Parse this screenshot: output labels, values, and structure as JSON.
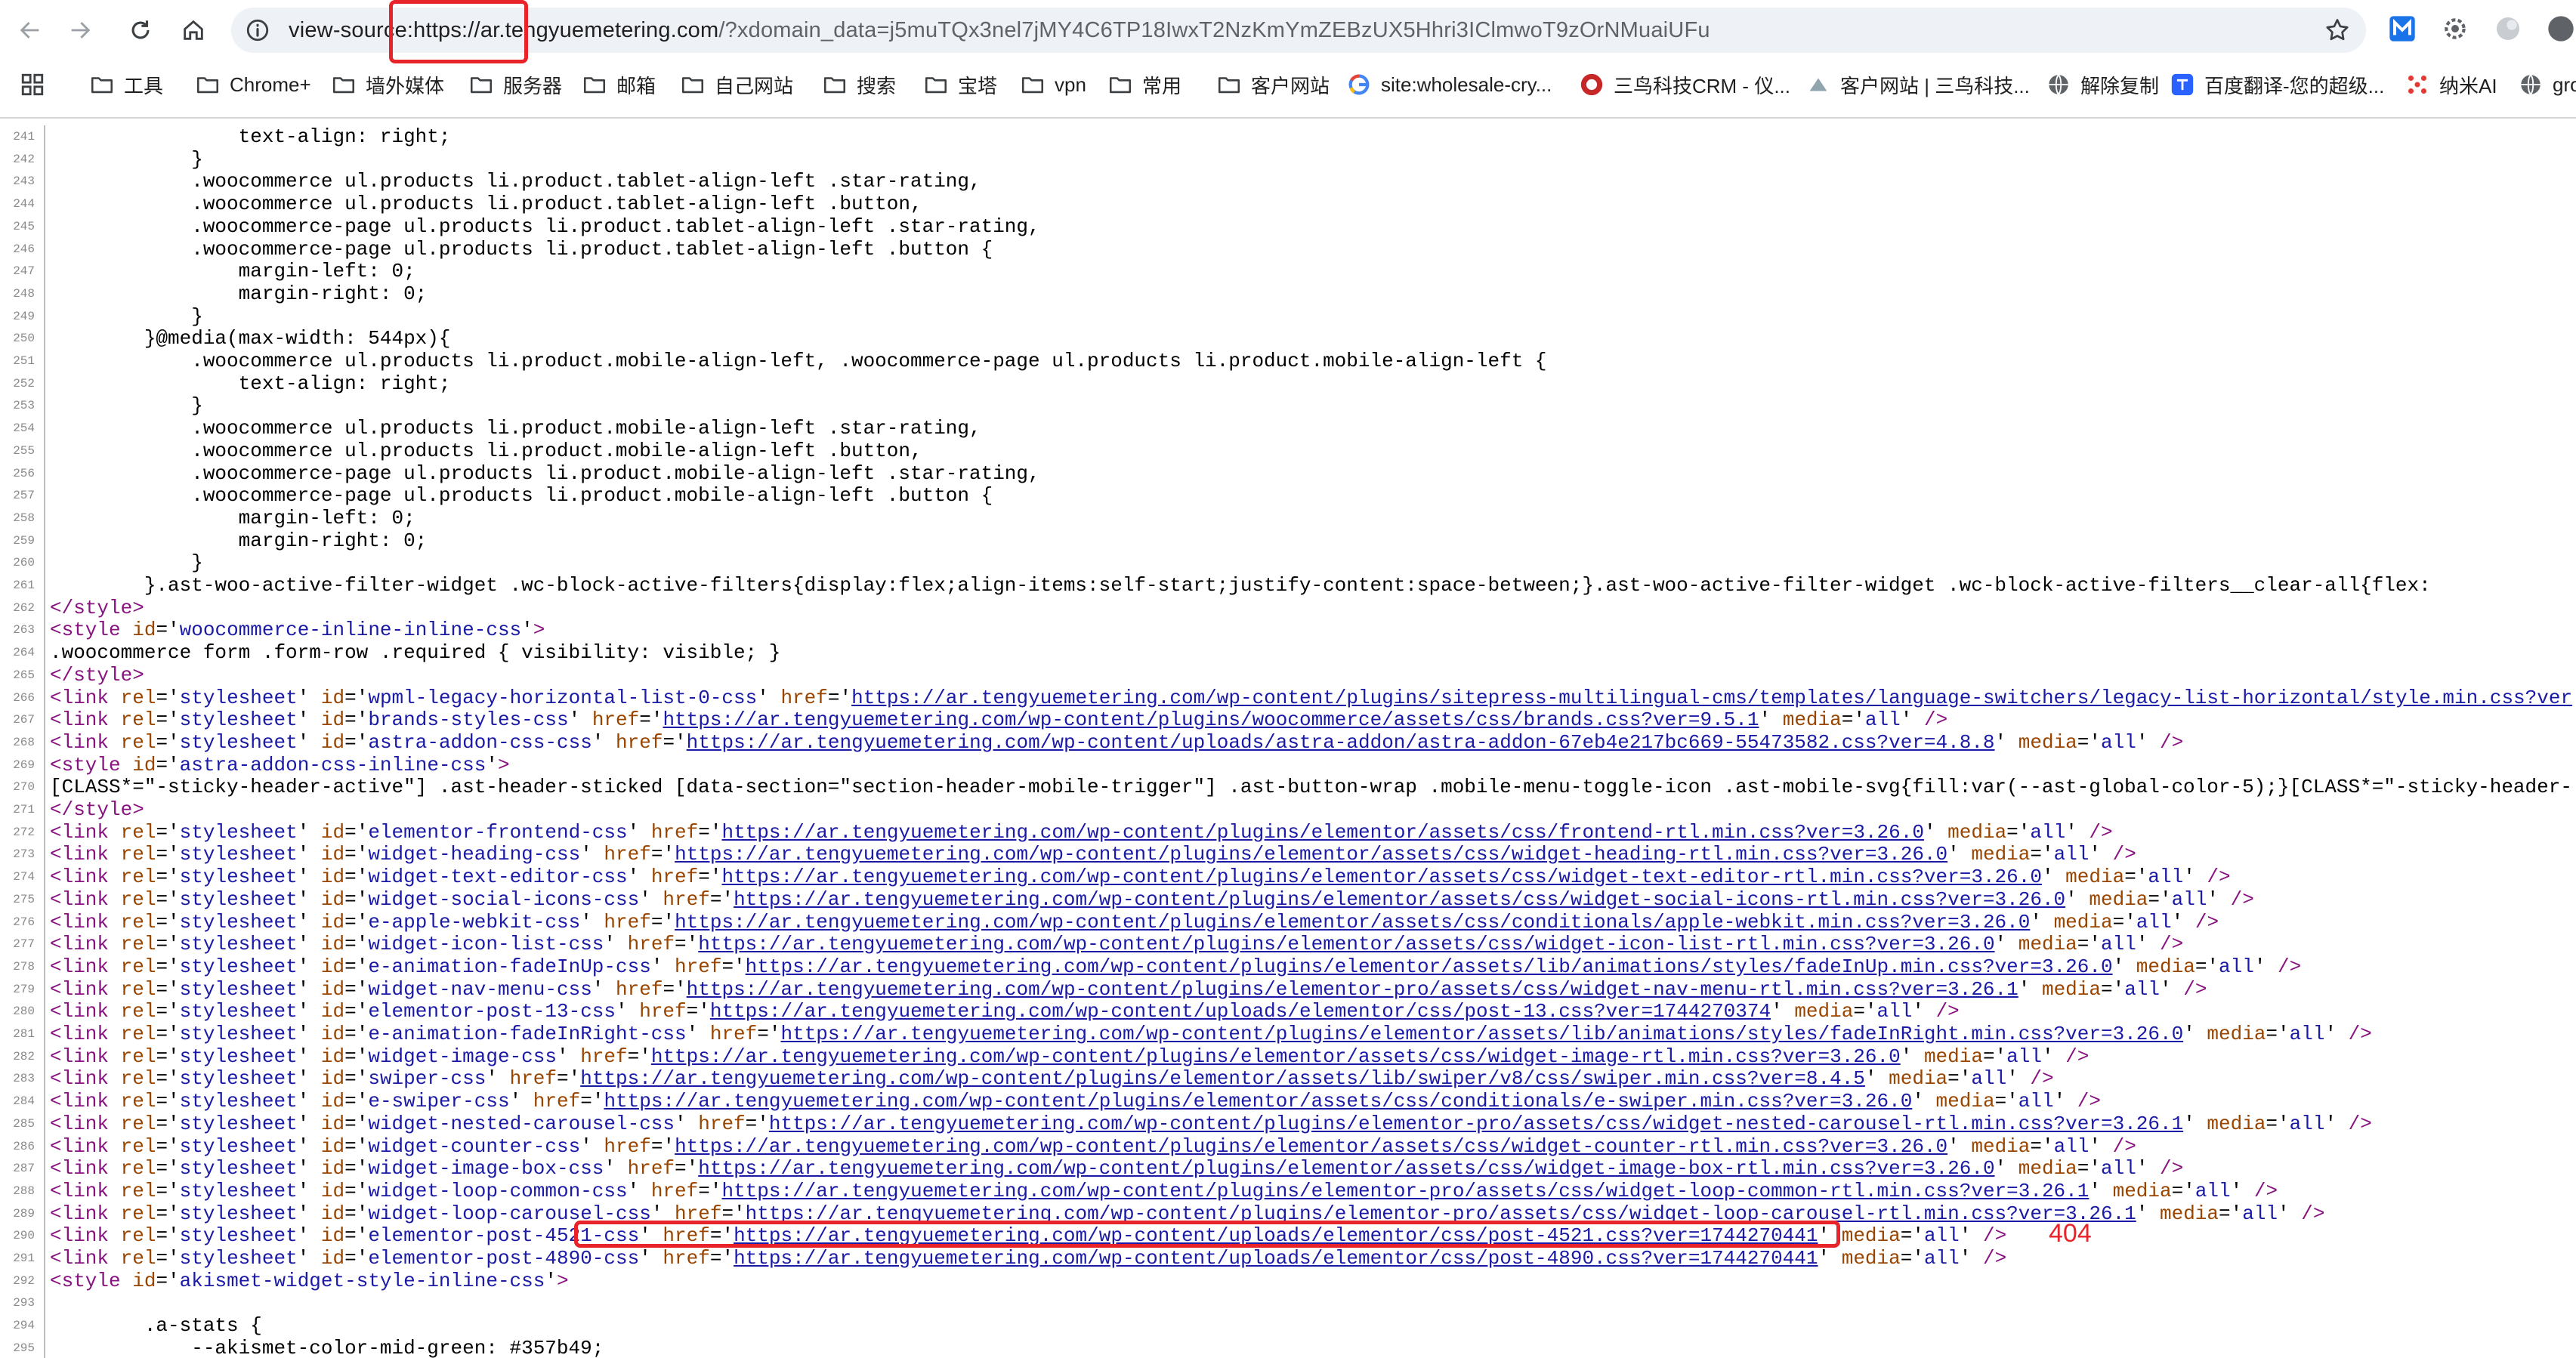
{
  "browser": {
    "url_prefix": "view-source:https://ar.",
    "url_domain": "tengyuemetering.com",
    "url_rest": "/?xdomain_data=j5muTQx3nel7jMY4C6TP18IwxT2NzKmYmZEBzUX5Hhri3IClmwoT9zOrNMuaiUFu"
  },
  "bookmarks": [
    {
      "label": "工具",
      "icon": "folder-icon"
    },
    {
      "label": "Chrome+",
      "icon": "folder-icon"
    },
    {
      "label": "墙外媒体",
      "icon": "folder-icon"
    },
    {
      "label": "服务器",
      "icon": "folder-icon"
    },
    {
      "label": "邮箱",
      "icon": "folder-icon"
    },
    {
      "label": "自己网站",
      "icon": "folder-icon"
    },
    {
      "label": "搜索",
      "icon": "folder-icon"
    },
    {
      "label": "宝塔",
      "icon": "folder-icon"
    },
    {
      "label": "vpn",
      "icon": "folder-icon"
    },
    {
      "label": "常用",
      "icon": "folder-icon"
    },
    {
      "label": "客户网站",
      "icon": "folder-icon"
    },
    {
      "label": "site:wholesale-cry...",
      "icon": "google-icon"
    },
    {
      "label": "三鸟科技CRM - 仪...",
      "icon": "crm-logo-icon"
    },
    {
      "label": "客户网站 | 三鸟科技...",
      "icon": "site-logo-icon"
    },
    {
      "label": "解除复制",
      "icon": "globe-icon"
    },
    {
      "label": "百度翻译-您的超级...",
      "icon": "translate-icon"
    },
    {
      "label": "纳米AI",
      "icon": "nami-icon"
    },
    {
      "label": "gro",
      "icon": "globe-icon"
    }
  ],
  "annotation": {
    "note": "404"
  },
  "source_lines": [
    {
      "n": "241",
      "t": "                text-align: right;"
    },
    {
      "n": "242",
      "t": "            }"
    },
    {
      "n": "243",
      "t": "            .woocommerce ul.products li.product.tablet-align-left .star-rating,"
    },
    {
      "n": "244",
      "t": "            .woocommerce ul.products li.product.tablet-align-left .button,"
    },
    {
      "n": "245",
      "t": "            .woocommerce-page ul.products li.product.tablet-align-left .star-rating,"
    },
    {
      "n": "246",
      "t": "            .woocommerce-page ul.products li.product.tablet-align-left .button {"
    },
    {
      "n": "247",
      "t": "                margin-left: 0;"
    },
    {
      "n": "248",
      "t": "                margin-right: 0;"
    },
    {
      "n": "249",
      "t": "            }"
    },
    {
      "n": "250",
      "t": "        }@media(max-width: 544px){"
    },
    {
      "n": "251",
      "t": "            .woocommerce ul.products li.product.mobile-align-left, .woocommerce-page ul.products li.product.mobile-align-left {"
    },
    {
      "n": "252",
      "t": "                text-align: right;"
    },
    {
      "n": "253",
      "t": "            }"
    },
    {
      "n": "254",
      "t": "            .woocommerce ul.products li.product.mobile-align-left .star-rating,"
    },
    {
      "n": "255",
      "t": "            .woocommerce ul.products li.product.mobile-align-left .button,"
    },
    {
      "n": "256",
      "t": "            .woocommerce-page ul.products li.product.mobile-align-left .star-rating,"
    },
    {
      "n": "257",
      "t": "            .woocommerce-page ul.products li.product.mobile-align-left .button {"
    },
    {
      "n": "258",
      "t": "                margin-left: 0;"
    },
    {
      "n": "259",
      "t": "                margin-right: 0;"
    },
    {
      "n": "260",
      "t": "            }"
    },
    {
      "n": "261",
      "t": "        }.ast-woo-active-filter-widget .wc-block-active-filters{display:flex;align-items:self-start;justify-content:space-between;}.ast-woo-active-filter-widget .wc-block-active-filters__clear-all{flex:"
    },
    {
      "n": "262",
      "tag": "</style>"
    },
    {
      "n": "263",
      "tag": "<style",
      "attrs": [
        {
          "a": "id",
          "v": "woocommerce-inline-inline-css"
        }
      ],
      "close": ">"
    },
    {
      "n": "264",
      "t": ".woocommerce form .form-row .required { visibility: visible; }"
    },
    {
      "n": "265",
      "tag": "</style>"
    },
    {
      "n": "266",
      "tag": "<link",
      "attrs": [
        {
          "a": "rel",
          "v": "stylesheet"
        },
        {
          "a": "id",
          "v": "wpml-legacy-horizontal-list-0-css"
        },
        {
          "a": "href",
          "link": "https://ar.tengyuemetering.com/wp-content/plugins/sitepress-multilingual-cms/templates/language-switchers/legacy-list-horizontal/style.min.css?ver"
        }
      ],
      "close": ""
    },
    {
      "n": "267",
      "tag": "<link",
      "attrs": [
        {
          "a": "rel",
          "v": "stylesheet"
        },
        {
          "a": "id",
          "v": "brands-styles-css"
        },
        {
          "a": "href",
          "link": "https://ar.tengyuemetering.com/wp-content/plugins/woocommerce/assets/css/brands.css?ver=9.5.1"
        },
        {
          "a": "media",
          "v": "all"
        }
      ],
      "close": " />"
    },
    {
      "n": "268",
      "tag": "<link",
      "attrs": [
        {
          "a": "rel",
          "v": "stylesheet"
        },
        {
          "a": "id",
          "v": "astra-addon-css-css"
        },
        {
          "a": "href",
          "link": "https://ar.tengyuemetering.com/wp-content/uploads/astra-addon/astra-addon-67eb4e217bc669-55473582.css?ver=4.8.8"
        },
        {
          "a": "media",
          "v": "all"
        }
      ],
      "close": " />"
    },
    {
      "n": "269",
      "tag": "<style",
      "attrs": [
        {
          "a": "id",
          "v": "astra-addon-css-inline-css"
        }
      ],
      "close": ">"
    },
    {
      "n": "270",
      "t": "[CLASS*=\"-sticky-header-active\"] .ast-header-sticked [data-section=\"section-header-mobile-trigger\"] .ast-button-wrap .mobile-menu-toggle-icon .ast-mobile-svg{fill:var(--ast-global-color-5);}[CLASS*=\"-sticky-header-"
    },
    {
      "n": "271",
      "tag": "</style>"
    },
    {
      "n": "272",
      "tag": "<link",
      "attrs": [
        {
          "a": "rel",
          "v": "stylesheet"
        },
        {
          "a": "id",
          "v": "elementor-frontend-css"
        },
        {
          "a": "href",
          "link": "https://ar.tengyuemetering.com/wp-content/plugins/elementor/assets/css/frontend-rtl.min.css?ver=3.26.0"
        },
        {
          "a": "media",
          "v": "all"
        }
      ],
      "close": " />"
    },
    {
      "n": "273",
      "tag": "<link",
      "attrs": [
        {
          "a": "rel",
          "v": "stylesheet"
        },
        {
          "a": "id",
          "v": "widget-heading-css"
        },
        {
          "a": "href",
          "link": "https://ar.tengyuemetering.com/wp-content/plugins/elementor/assets/css/widget-heading-rtl.min.css?ver=3.26.0"
        },
        {
          "a": "media",
          "v": "all"
        }
      ],
      "close": " />"
    },
    {
      "n": "274",
      "tag": "<link",
      "attrs": [
        {
          "a": "rel",
          "v": "stylesheet"
        },
        {
          "a": "id",
          "v": "widget-text-editor-css"
        },
        {
          "a": "href",
          "link": "https://ar.tengyuemetering.com/wp-content/plugins/elementor/assets/css/widget-text-editor-rtl.min.css?ver=3.26.0"
        },
        {
          "a": "media",
          "v": "all"
        }
      ],
      "close": " />"
    },
    {
      "n": "275",
      "tag": "<link",
      "attrs": [
        {
          "a": "rel",
          "v": "stylesheet"
        },
        {
          "a": "id",
          "v": "widget-social-icons-css"
        },
        {
          "a": "href",
          "link": "https://ar.tengyuemetering.com/wp-content/plugins/elementor/assets/css/widget-social-icons-rtl.min.css?ver=3.26.0"
        },
        {
          "a": "media",
          "v": "all"
        }
      ],
      "close": " />"
    },
    {
      "n": "276",
      "tag": "<link",
      "attrs": [
        {
          "a": "rel",
          "v": "stylesheet"
        },
        {
          "a": "id",
          "v": "e-apple-webkit-css"
        },
        {
          "a": "href",
          "link": "https://ar.tengyuemetering.com/wp-content/plugins/elementor/assets/css/conditionals/apple-webkit.min.css?ver=3.26.0"
        },
        {
          "a": "media",
          "v": "all"
        }
      ],
      "close": " />"
    },
    {
      "n": "277",
      "tag": "<link",
      "attrs": [
        {
          "a": "rel",
          "v": "stylesheet"
        },
        {
          "a": "id",
          "v": "widget-icon-list-css"
        },
        {
          "a": "href",
          "link": "https://ar.tengyuemetering.com/wp-content/plugins/elementor/assets/css/widget-icon-list-rtl.min.css?ver=3.26.0"
        },
        {
          "a": "media",
          "v": "all"
        }
      ],
      "close": " />"
    },
    {
      "n": "278",
      "tag": "<link",
      "attrs": [
        {
          "a": "rel",
          "v": "stylesheet"
        },
        {
          "a": "id",
          "v": "e-animation-fadeInUp-css"
        },
        {
          "a": "href",
          "link": "https://ar.tengyuemetering.com/wp-content/plugins/elementor/assets/lib/animations/styles/fadeInUp.min.css?ver=3.26.0"
        },
        {
          "a": "media",
          "v": "all"
        }
      ],
      "close": " />"
    },
    {
      "n": "279",
      "tag": "<link",
      "attrs": [
        {
          "a": "rel",
          "v": "stylesheet"
        },
        {
          "a": "id",
          "v": "widget-nav-menu-css"
        },
        {
          "a": "href",
          "link": "https://ar.tengyuemetering.com/wp-content/plugins/elementor-pro/assets/css/widget-nav-menu-rtl.min.css?ver=3.26.1"
        },
        {
          "a": "media",
          "v": "all"
        }
      ],
      "close": " />"
    },
    {
      "n": "280",
      "tag": "<link",
      "attrs": [
        {
          "a": "rel",
          "v": "stylesheet"
        },
        {
          "a": "id",
          "v": "elementor-post-13-css"
        },
        {
          "a": "href",
          "link": "https://ar.tengyuemetering.com/wp-content/uploads/elementor/css/post-13.css?ver=1744270374"
        },
        {
          "a": "media",
          "v": "all"
        }
      ],
      "close": " />"
    },
    {
      "n": "281",
      "tag": "<link",
      "attrs": [
        {
          "a": "rel",
          "v": "stylesheet"
        },
        {
          "a": "id",
          "v": "e-animation-fadeInRight-css"
        },
        {
          "a": "href",
          "link": "https://ar.tengyuemetering.com/wp-content/plugins/elementor/assets/lib/animations/styles/fadeInRight.min.css?ver=3.26.0"
        },
        {
          "a": "media",
          "v": "all"
        }
      ],
      "close": " />"
    },
    {
      "n": "282",
      "tag": "<link",
      "attrs": [
        {
          "a": "rel",
          "v": "stylesheet"
        },
        {
          "a": "id",
          "v": "widget-image-css"
        },
        {
          "a": "href",
          "link": "https://ar.tengyuemetering.com/wp-content/plugins/elementor/assets/css/widget-image-rtl.min.css?ver=3.26.0"
        },
        {
          "a": "media",
          "v": "all"
        }
      ],
      "close": " />"
    },
    {
      "n": "283",
      "tag": "<link",
      "attrs": [
        {
          "a": "rel",
          "v": "stylesheet"
        },
        {
          "a": "id",
          "v": "swiper-css"
        },
        {
          "a": "href",
          "link": "https://ar.tengyuemetering.com/wp-content/plugins/elementor/assets/lib/swiper/v8/css/swiper.min.css?ver=8.4.5"
        },
        {
          "a": "media",
          "v": "all"
        }
      ],
      "close": " />"
    },
    {
      "n": "284",
      "tag": "<link",
      "attrs": [
        {
          "a": "rel",
          "v": "stylesheet"
        },
        {
          "a": "id",
          "v": "e-swiper-css"
        },
        {
          "a": "href",
          "link": "https://ar.tengyuemetering.com/wp-content/plugins/elementor/assets/css/conditionals/e-swiper.min.css?ver=3.26.0"
        },
        {
          "a": "media",
          "v": "all"
        }
      ],
      "close": " />"
    },
    {
      "n": "285",
      "tag": "<link",
      "attrs": [
        {
          "a": "rel",
          "v": "stylesheet"
        },
        {
          "a": "id",
          "v": "widget-nested-carousel-css"
        },
        {
          "a": "href",
          "link": "https://ar.tengyuemetering.com/wp-content/plugins/elementor-pro/assets/css/widget-nested-carousel-rtl.min.css?ver=3.26.1"
        },
        {
          "a": "media",
          "v": "all"
        }
      ],
      "close": " />"
    },
    {
      "n": "286",
      "tag": "<link",
      "attrs": [
        {
          "a": "rel",
          "v": "stylesheet"
        },
        {
          "a": "id",
          "v": "widget-counter-css"
        },
        {
          "a": "href",
          "link": "https://ar.tengyuemetering.com/wp-content/plugins/elementor/assets/css/widget-counter-rtl.min.css?ver=3.26.0"
        },
        {
          "a": "media",
          "v": "all"
        }
      ],
      "close": " />"
    },
    {
      "n": "287",
      "tag": "<link",
      "attrs": [
        {
          "a": "rel",
          "v": "stylesheet"
        },
        {
          "a": "id",
          "v": "widget-image-box-css"
        },
        {
          "a": "href",
          "link": "https://ar.tengyuemetering.com/wp-content/plugins/elementor/assets/css/widget-image-box-rtl.min.css?ver=3.26.0"
        },
        {
          "a": "media",
          "v": "all"
        }
      ],
      "close": " />"
    },
    {
      "n": "288",
      "tag": "<link",
      "attrs": [
        {
          "a": "rel",
          "v": "stylesheet"
        },
        {
          "a": "id",
          "v": "widget-loop-common-css"
        },
        {
          "a": "href",
          "link": "https://ar.tengyuemetering.com/wp-content/plugins/elementor-pro/assets/css/widget-loop-common-rtl.min.css?ver=3.26.1"
        },
        {
          "a": "media",
          "v": "all"
        }
      ],
      "close": " />"
    },
    {
      "n": "289",
      "tag": "<link",
      "attrs": [
        {
          "a": "rel",
          "v": "stylesheet"
        },
        {
          "a": "id",
          "v": "widget-loop-carousel-css"
        },
        {
          "a": "href",
          "link": "https://ar.tengyuemetering.com/wp-content/plugins/elementor-pro/assets/css/widget-loop-carousel-rtl.min.css?ver=3.26.1"
        },
        {
          "a": "media",
          "v": "all"
        }
      ],
      "close": " />"
    },
    {
      "n": "290",
      "tag": "<link",
      "attrs": [
        {
          "a": "rel",
          "v": "stylesheet"
        },
        {
          "a": "id",
          "v": "elementor-post-4521-css"
        },
        {
          "a": "href",
          "link": "https://ar.tengyuemetering.com/wp-content/uploads/elementor/css/post-4521.css?ver=1744270441"
        },
        {
          "a": "media",
          "v": "all"
        }
      ],
      "close": " />"
    },
    {
      "n": "291",
      "tag": "<link",
      "attrs": [
        {
          "a": "rel",
          "v": "stylesheet"
        },
        {
          "a": "id",
          "v": "elementor-post-4890-css"
        },
        {
          "a": "href",
          "link": "https://ar.tengyuemetering.com/wp-content/uploads/elementor/css/post-4890.css?ver=1744270441"
        },
        {
          "a": "media",
          "v": "all"
        }
      ],
      "close": " />"
    },
    {
      "n": "292",
      "tag": "<style",
      "attrs": [
        {
          "a": "id",
          "v": "akismet-widget-style-inline-css"
        }
      ],
      "close": ">"
    },
    {
      "n": "293",
      "t": ""
    },
    {
      "n": "294",
      "t": "        .a-stats {"
    },
    {
      "n": "295",
      "t": "            --akismet-color-mid-green: #357b49;"
    }
  ]
}
